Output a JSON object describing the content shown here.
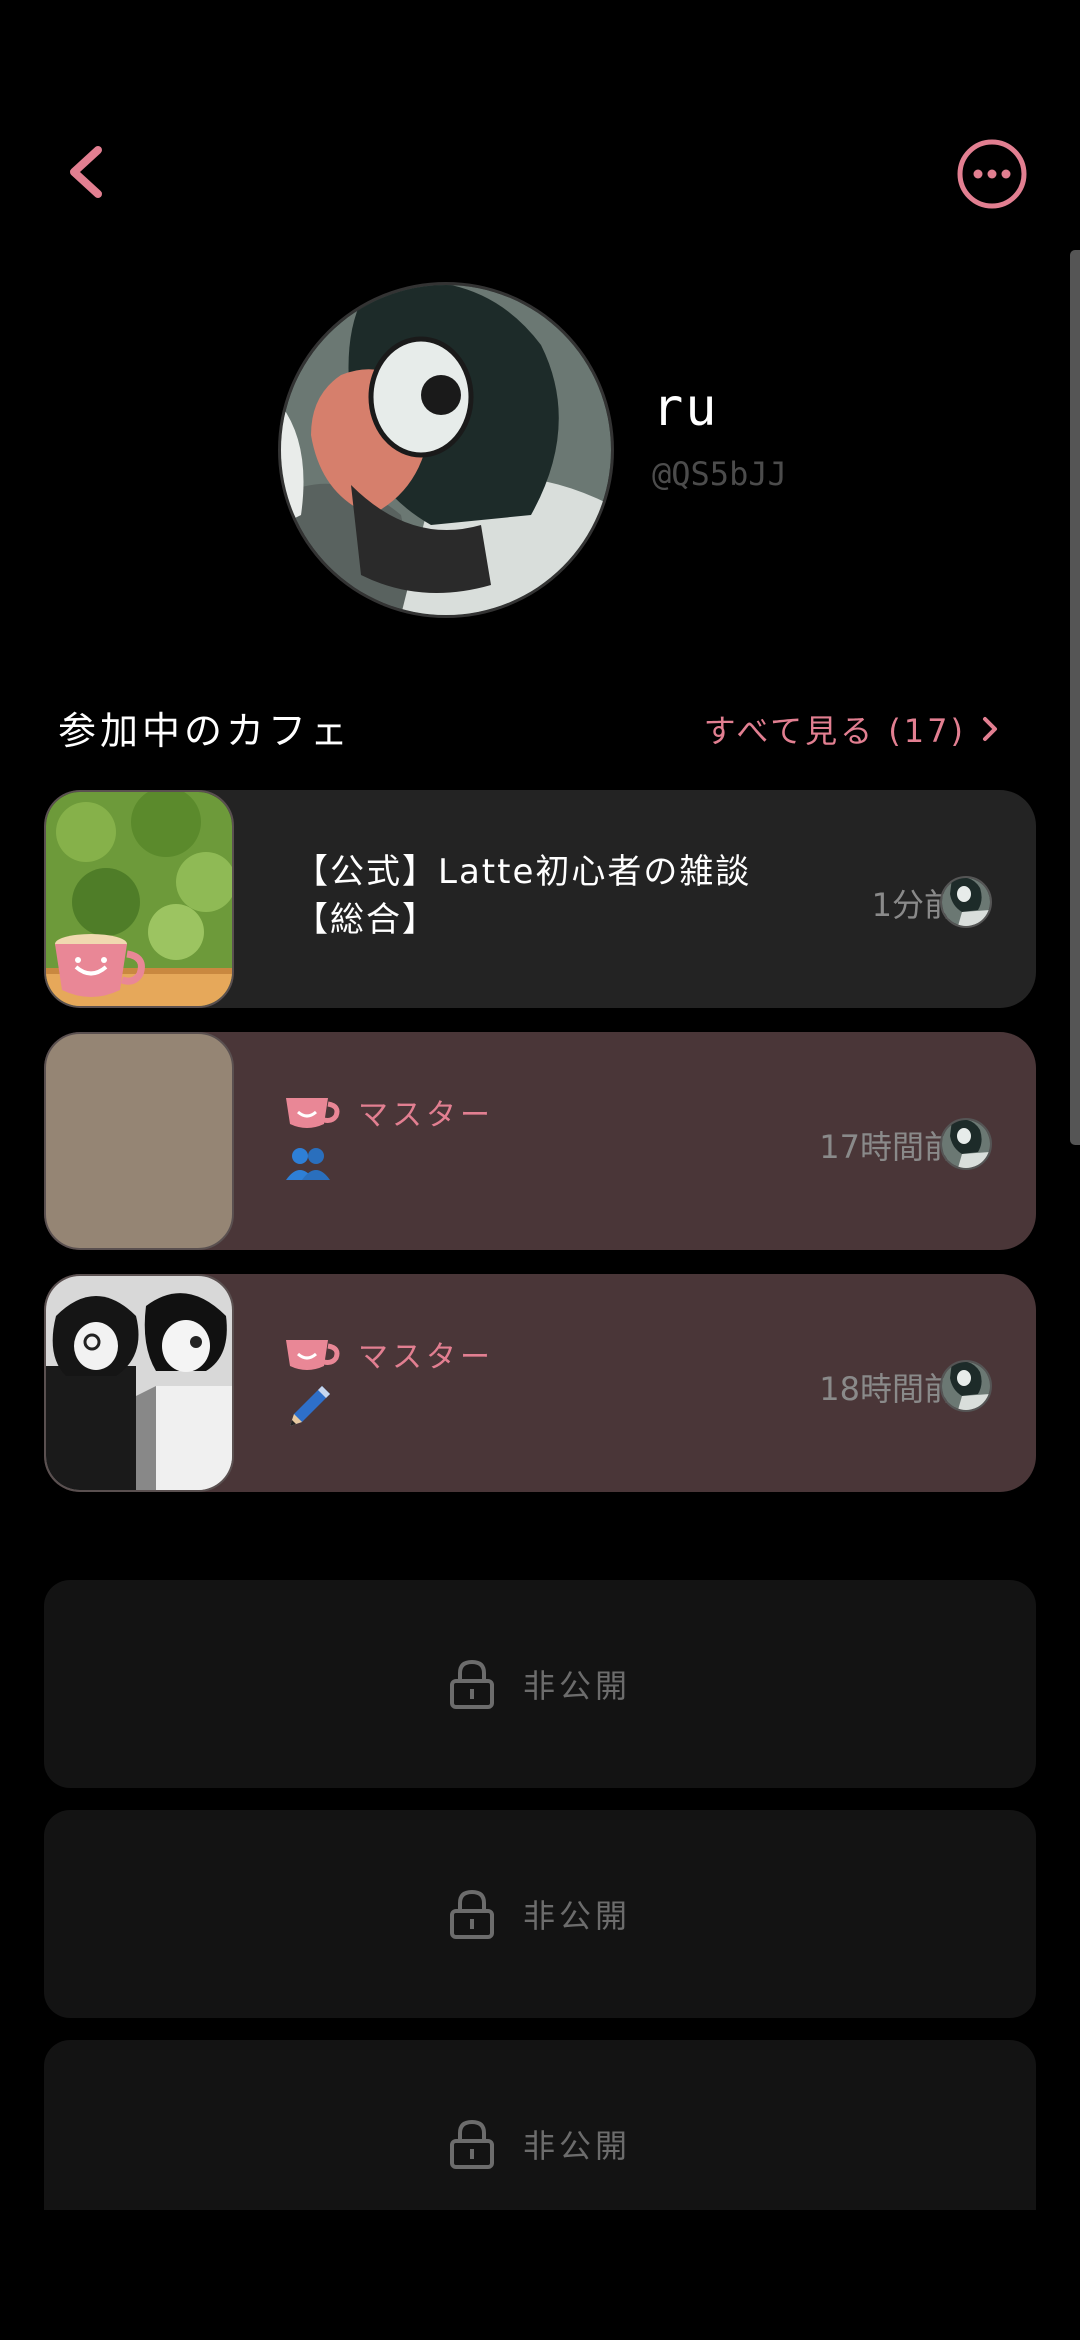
{
  "header": {
    "back_icon": "chevron-left-icon",
    "more_icon": "more-horizontal-icon",
    "accent_color": "#e27f91"
  },
  "profile": {
    "name": "ru",
    "handle": "@QS5bJJ"
  },
  "cafes_section": {
    "title": "参加中のカフェ",
    "see_all_label": "すべて見る (17)"
  },
  "cafes": [
    {
      "name_line1": "【公式】Latte初心者の雑談",
      "name_line2": "【総合】",
      "time": "1分前"
    },
    {
      "role": "マスター",
      "emoji": "people-icon",
      "time": "17時間前"
    },
    {
      "role": "マスター",
      "emoji": "pen-icon",
      "time": "18時間前"
    }
  ],
  "private_cards": [
    {
      "label": "非公開"
    },
    {
      "label": "非公開"
    },
    {
      "label": "非公開"
    }
  ]
}
